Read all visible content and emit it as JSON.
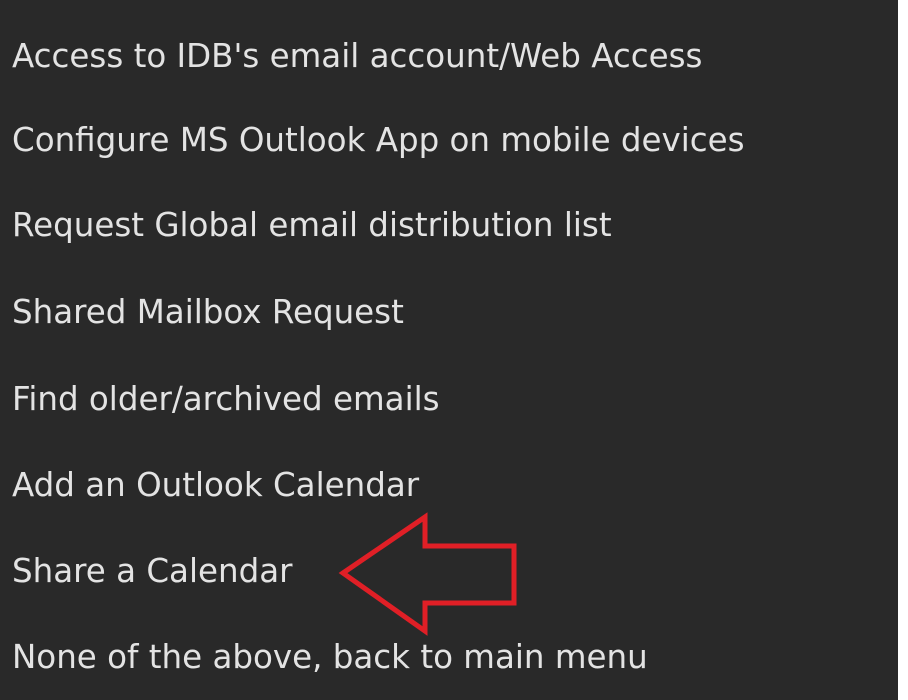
{
  "menu": {
    "items": [
      {
        "label": "Access to IDB's email account/Web Access"
      },
      {
        "label": "Configure MS Outlook App on mobile devices"
      },
      {
        "label": "Request Global email distribution list"
      },
      {
        "label": "Shared Mailbox Request"
      },
      {
        "label": "Find older/archived emails"
      },
      {
        "label": "Add an Outlook Calendar"
      },
      {
        "label": "Share a Calendar"
      },
      {
        "label": "None of the above, back to main menu"
      }
    ]
  },
  "annotation": {
    "icon": "red-outline-arrow-icon",
    "color": "#e01f26"
  },
  "colors": {
    "background": "#292929",
    "text": "#e3e3e3"
  }
}
